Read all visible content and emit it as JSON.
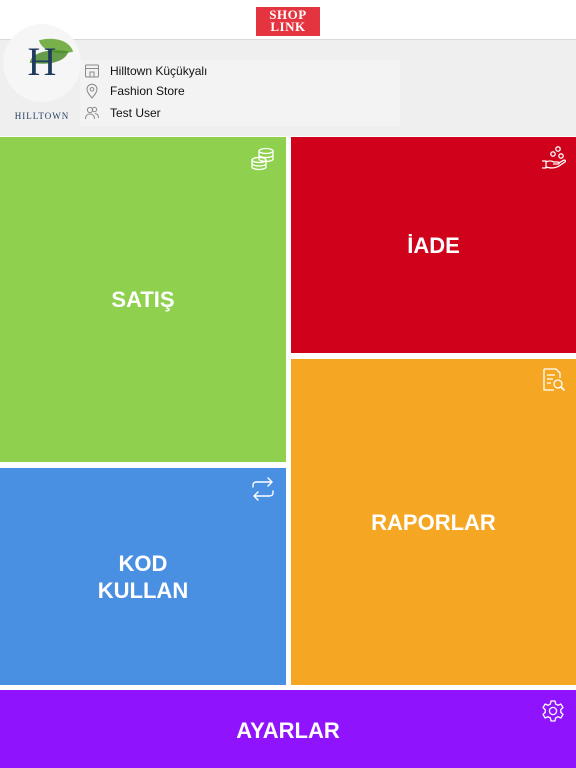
{
  "header": {
    "logo_line1": "SHOP",
    "logo_line2": "LINK"
  },
  "store": {
    "logo_letter": "H",
    "logo_caption": "HILLTOWN",
    "location": "Hilltown Küçükyalı",
    "store_name": "Fashion Store",
    "user": "Test User"
  },
  "tiles": {
    "satis": {
      "label": "SATIŞ",
      "icon": "coins-stack-icon",
      "color": "#8fd14f"
    },
    "iade": {
      "label": "İADE",
      "icon": "hand-money-icon",
      "color": "#d0021b"
    },
    "raporlar": {
      "label": "RAPORLAR",
      "icon": "report-search-icon",
      "color": "#f5a623"
    },
    "kod": {
      "label": "KOD\nKULLAN",
      "icon": "exchange-arrows-icon",
      "color": "#4a90e2"
    },
    "ayarlar": {
      "label": "AYARLAR",
      "icon": "gear-icon",
      "color": "#9013fe"
    }
  },
  "colors": {
    "brand": "#e4343f",
    "info_background": "#efefef"
  }
}
